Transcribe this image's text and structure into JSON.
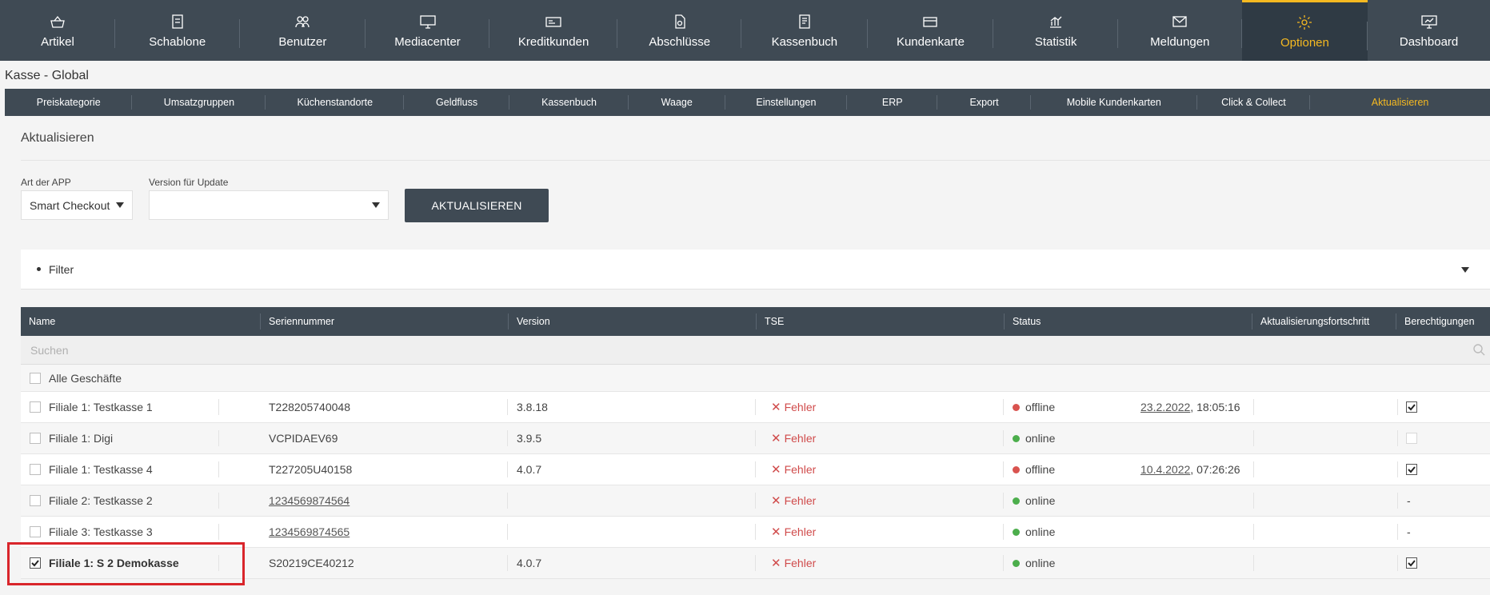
{
  "topnav": [
    {
      "label": "Artikel",
      "icon": "basket-icon"
    },
    {
      "label": "Schablone",
      "icon": "document-icon"
    },
    {
      "label": "Benutzer",
      "icon": "users-icon"
    },
    {
      "label": "Mediacenter",
      "icon": "monitor-icon"
    },
    {
      "label": "Kreditkunden",
      "icon": "card-icon"
    },
    {
      "label": "Abschlüsse",
      "icon": "file-icon"
    },
    {
      "label": "Kassenbuch",
      "icon": "book-icon"
    },
    {
      "label": "Kundenkarte",
      "icon": "customer-card-icon"
    },
    {
      "label": "Statistik",
      "icon": "chart-icon"
    },
    {
      "label": "Meldungen",
      "icon": "mail-icon"
    },
    {
      "label": "Optionen",
      "icon": "gear-icon",
      "active": true
    },
    {
      "label": "Dashboard",
      "icon": "dashboard-icon"
    }
  ],
  "page_heading": "Kasse - Global",
  "subnav": [
    {
      "label": "Preiskategorie"
    },
    {
      "label": "Umsatzgruppen"
    },
    {
      "label": "Küchenstandorte"
    },
    {
      "label": "Geldfluss"
    },
    {
      "label": "Kassenbuch"
    },
    {
      "label": "Waage"
    },
    {
      "label": "Einstellungen"
    },
    {
      "label": "ERP"
    },
    {
      "label": "Export"
    },
    {
      "label": "Mobile Kundenkarten"
    },
    {
      "label": "Click & Collect"
    },
    {
      "label": "Aktualisieren",
      "active": true
    }
  ],
  "section_title": "Aktualisieren",
  "form": {
    "app_type_label": "Art der APP",
    "app_type_value": "Smart Checkout",
    "version_label": "Version für Update",
    "version_value": "",
    "update_button": "AKTUALISIEREN"
  },
  "filter": {
    "label": "Filter"
  },
  "table": {
    "headers": [
      "Name",
      "Seriennummer",
      "Version",
      "TSE",
      "Status",
      "Aktualisierungsfortschritt",
      "Berechtigungen"
    ],
    "search_placeholder": "Suchen",
    "all_stores_label": "Alle Geschäfte",
    "rows": [
      {
        "name": "Filiale 1: Testkasse 1",
        "serial": "T228205740048",
        "serial_link": false,
        "version": "3.8.18",
        "tse": "Fehler",
        "status": "offline",
        "last_seen_date": "23.2.2022",
        "last_seen_time": ", 18:05:16",
        "selected": false,
        "permission": "checked"
      },
      {
        "name": "Filiale 1: Digi",
        "serial": "VCPIDAEV69",
        "serial_link": false,
        "version": "3.9.5",
        "tse": "Fehler",
        "status": "online",
        "last_seen_date": "",
        "last_seen_time": "",
        "selected": false,
        "permission": "unchecked"
      },
      {
        "name": "Filiale 1: Testkasse 4",
        "serial": "T227205U40158",
        "serial_link": false,
        "version": "4.0.7",
        "tse": "Fehler",
        "status": "offline",
        "last_seen_date": "10.4.2022",
        "last_seen_time": ", 07:26:26",
        "selected": false,
        "permission": "checked"
      },
      {
        "name": "Filiale 2: Testkasse 2",
        "serial": "1234569874564",
        "serial_link": true,
        "version": "",
        "tse": "Fehler",
        "status": "online",
        "last_seen_date": "",
        "last_seen_time": "",
        "selected": false,
        "permission": "-"
      },
      {
        "name": "Filiale 3: Testkasse 3",
        "serial": "1234569874565",
        "serial_link": true,
        "version": "",
        "tse": "Fehler",
        "status": "online",
        "last_seen_date": "",
        "last_seen_time": "",
        "selected": false,
        "permission": "-"
      },
      {
        "name": "Filiale 1: S 2 Demokasse",
        "serial": "S20219CE40212",
        "serial_link": false,
        "version": "4.0.7",
        "tse": "Fehler",
        "status": "online",
        "last_seen_date": "",
        "last_seen_time": "",
        "selected": true,
        "permission": "checked"
      }
    ]
  },
  "colors": {
    "nav_bg": "#3f4a54",
    "accent": "#f5b921",
    "error": "#d04b4b",
    "offline": "#d9534f",
    "online": "#4cae4c",
    "highlight": "#d9252b"
  }
}
